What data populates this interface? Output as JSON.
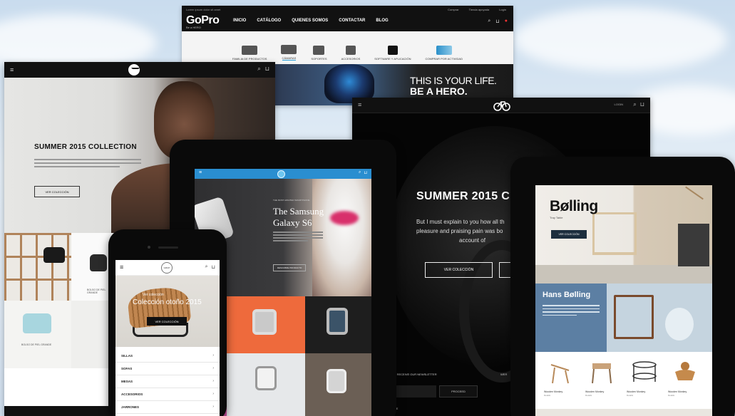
{
  "gopro": {
    "tiny_text": "Lorem ipsum dolor sit amet",
    "top_links": [
      "Comprar",
      "Tienda apoyada",
      "Login"
    ],
    "logo": "GoPro",
    "logo_sub": "Be a HERO",
    "nav": [
      "INICIO",
      "CATÁLOGO",
      "QUIENES SOMOS",
      "CONTACTAR",
      "BLOG"
    ],
    "categories": [
      {
        "label": "FAMILIA DE PRODUCTOS"
      },
      {
        "label": "CÁMARAS"
      },
      {
        "label": "SOPORTES"
      },
      {
        "label": "ACCESORIOS"
      },
      {
        "label": "SOFTWARE Y APLICACIÓN"
      },
      {
        "label": "COMPRAR POR ACTIVIDAD"
      }
    ],
    "active_category": "CÁMARAS",
    "hero_line1": "THIS IS YOUR LIFE.",
    "hero_line2": "BE A HERO."
  },
  "fashion": {
    "title": "SUMMER 2015 COLLECTION",
    "button": "VER COLECCIÓN",
    "product_caption1": "BOLSO DE PIEL GRANDE",
    "product_caption2": "BOLSO DE PIEL GRANDE"
  },
  "bike": {
    "login": "LOGIN",
    "title": "SUMMER 2015 C",
    "line1": "But I must explain to you how all th",
    "line2": "pleasure and praising pain was bo",
    "line3": "account of",
    "button": "VER COLECCIÓN",
    "newsletter": "TO RECEIVE OUR NEWSLETTER",
    "proceed": "PROCEED",
    "wer": "WER",
    "ive": "IVE"
  },
  "samsung": {
    "kicker": "THE MOST AWAITED SMARTPHONE",
    "title_line1": "The Samsung",
    "title_line2": "Galaxy S6",
    "button": "DESCUBRE PRODUCTO"
  },
  "bolling": {
    "logo": "Bølling",
    "subtitle": "Tray Table",
    "button": "VER COLECCIÓN",
    "designer": "Hans Bølling",
    "products": [
      {
        "name": "Wooden Monkey",
        "sub": "Details"
      },
      {
        "name": "Wooden Monkey",
        "sub": "Details"
      },
      {
        "name": "Wooden Monkey",
        "sub": "Details"
      },
      {
        "name": "Wooden Monkey",
        "sub": "Details"
      }
    ]
  },
  "phone": {
    "logo": "GRUP",
    "hero_small": "Ver colección",
    "hero_title": "Colección otoño 2015",
    "button": "VER COLECCIÓN",
    "menu_items": [
      "SILLAS",
      "SOFAS",
      "MESAS",
      "ACCESORIOS",
      "JARRONES"
    ]
  },
  "colors": {
    "samsung_bar": "#2a8ed0",
    "bolling_button": "#1c2e3e",
    "gopro_active_underline": "#2a9fd8"
  }
}
